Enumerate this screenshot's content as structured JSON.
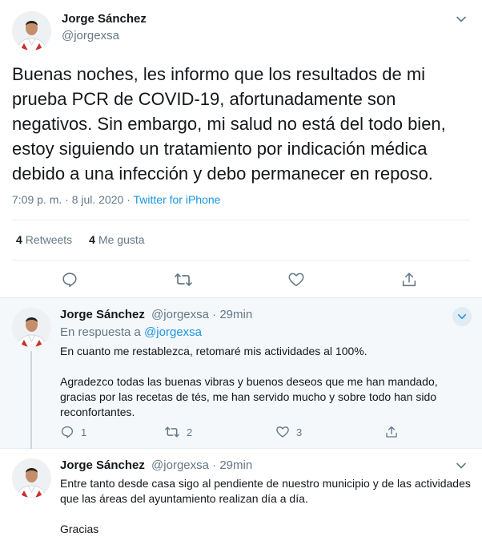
{
  "main_tweet": {
    "name": "Jorge Sánchez",
    "handle": "@jorgexsa",
    "text": "Buenas noches, les informo que los resultados de mi prueba PCR de COVID-19, afortunadamente son negativos. Sin embargo, mi salud no está del todo bien, estoy siguiendo un tratamiento por indicación médica debido a una infección y debo permanecer en reposo.",
    "time": "7:09 p. m. · 8 jul. 2020",
    "separator": " · ",
    "source": "Twitter for iPhone",
    "retweets_count": "4",
    "retweets_label": "Retweets",
    "likes_count": "4",
    "likes_label": "Me gusta",
    "icons": [
      "chevron-down-icon",
      "reply-icon",
      "retweet-icon",
      "like-icon",
      "share-icon"
    ]
  },
  "replies": [
    {
      "name": "Jorge Sánchez",
      "handle": "@jorgexsa",
      "time": "· 29min",
      "in_reply_prefix": "En respuesta a",
      "in_reply_handle": "@jorgexsa",
      "paragraphs": [
        "En cuanto me restablezca, retomaré mis actividades al 100%.",
        "Agradezco todas las buenas vibras y buenos deseos que me han mandado, gracias por las recetas de tés, me han servido mucho y sobre todo han sido reconfortantes."
      ],
      "reply_count": "1",
      "retweet_count": "2",
      "like_count": "3"
    },
    {
      "name": "Jorge Sánchez",
      "handle": "@jorgexsa",
      "time": "· 29min",
      "paragraphs": [
        "Entre tanto desde casa sigo al pendiente de nuestro municipio y de las actividades que las áreas del ayuntamiento realizan día a día.",
        "Gracias"
      ]
    }
  ],
  "colors": {
    "text": "#14171a",
    "secondary": "#657786",
    "link": "#1b95e0",
    "reply_bg": "#f5f8fa",
    "border": "#e6ecf0"
  }
}
